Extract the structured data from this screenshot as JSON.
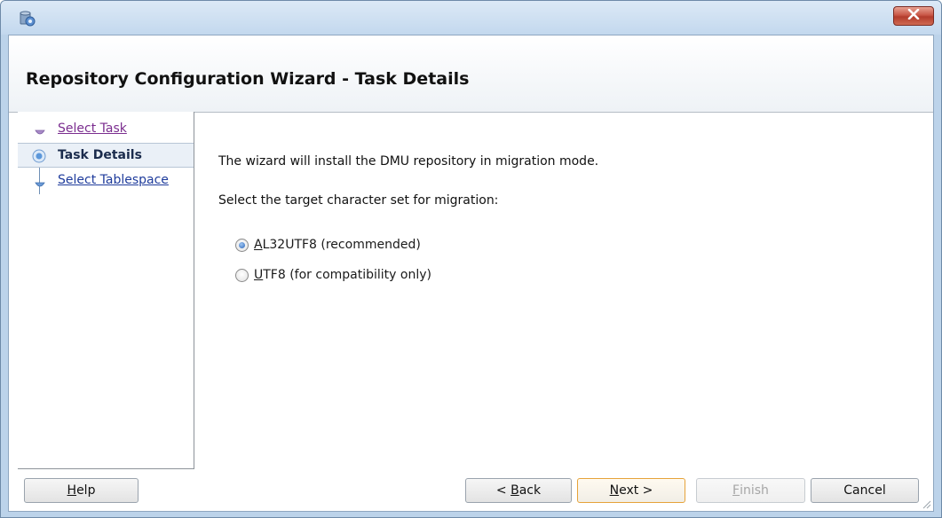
{
  "window": {
    "icon": "database-wizard-icon",
    "close_icon": "close-icon",
    "accent": "#c85747"
  },
  "header": {
    "title": "Repository Configuration Wizard - Task Details"
  },
  "nav": {
    "items": [
      {
        "label": "Select Task",
        "state": "visited"
      },
      {
        "label": "Task Details",
        "state": "current"
      },
      {
        "label": "Select Tablespace",
        "state": "link"
      }
    ]
  },
  "main": {
    "intro": "The wizard will install the DMU repository in migration mode.",
    "prompt": "Select the target character set for migration:",
    "options": [
      {
        "mnemonic": "A",
        "rest": "L32UTF8 (recommended)",
        "selected": true
      },
      {
        "mnemonic": "U",
        "rest": "TF8 (for compatibility only)",
        "selected": false
      }
    ]
  },
  "buttons": {
    "help": {
      "mnemonic": "H",
      "rest": "elp"
    },
    "back": {
      "prefix": "< ",
      "mnemonic": "B",
      "rest": "ack"
    },
    "next": {
      "mnemonic": "N",
      "rest": "ext >"
    },
    "finish": {
      "mnemonic": "F",
      "rest": "inish",
      "disabled": true
    },
    "cancel": {
      "label": "Cancel"
    }
  }
}
